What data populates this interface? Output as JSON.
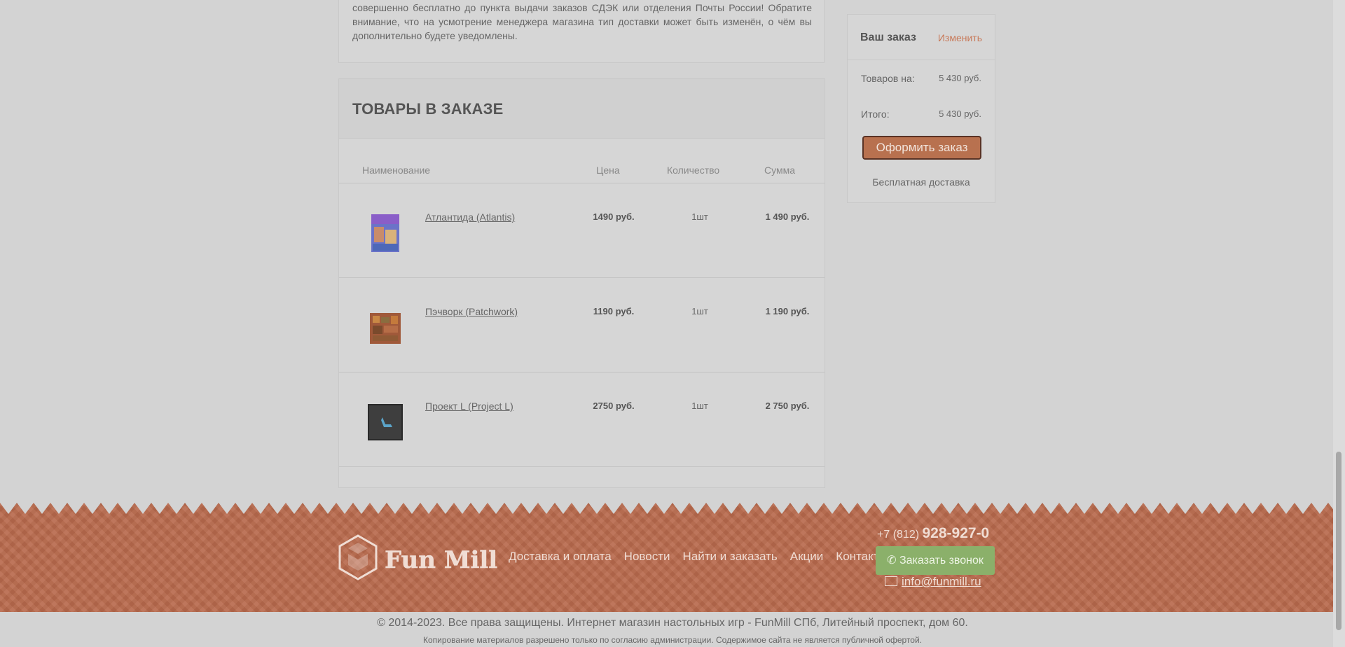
{
  "delivery_notice": {
    "text": "совершенно бесплатно до пункта выдачи заказов СДЭК или отделения Почты России! Обратите внимание, что на усмотрение менеджера магазина тип доставки может быть изменён, о чём вы дополнительно будете уведомлены."
  },
  "order_items": {
    "title": "ТОВАРЫ В ЗАКАЗЕ",
    "columns": {
      "name": "Наименование",
      "price": "Цена",
      "quantity": "Количество",
      "sum": "Сумма"
    },
    "rows": [
      {
        "name": "Атлантида (Atlantis)",
        "price": "1490 руб.",
        "quantity": "1шт",
        "sum": "1 490 руб."
      },
      {
        "name": "Пэчворк (Patchwork)",
        "price": "1190 руб.",
        "quantity": "1шт",
        "sum": "1 190 руб."
      },
      {
        "name": "Проект L (Project L)",
        "price": "2750 руб.",
        "quantity": "1шт",
        "sum": "2 750 руб."
      }
    ]
  },
  "summary": {
    "title": "Ваш заказ",
    "edit_label": "Изменить",
    "goods_label": "Товаров на:",
    "goods_value": "5 430 руб.",
    "total_label": "Итого:",
    "total_value": "5 430 руб.",
    "order_button": "Оформить заказ",
    "free_delivery": "Бесплатная доставка"
  },
  "footer": {
    "logo_text": "Fun Mill",
    "nav": [
      "Доставка и оплата",
      "Новости",
      "Найти и заказать",
      "Акции",
      "Контакты"
    ],
    "phone_code": "+7 (812)",
    "phone_number": "928-927-0",
    "call_button": "Заказать звонок",
    "email": "info@funmill.ru",
    "copyright": "© 2014-2023. Все права защищены. Интернет магазин настольных игр - FunMill СПб, Литейный проспект, дом 60.",
    "copyright_note": "Копирование материалов разрешено только по согласию администрации. Содержимое сайта не является публичной офертой."
  },
  "colors": {
    "accent": "#b8714f",
    "footer_bg": "#b8694c",
    "call_button": "#8bb06a"
  }
}
